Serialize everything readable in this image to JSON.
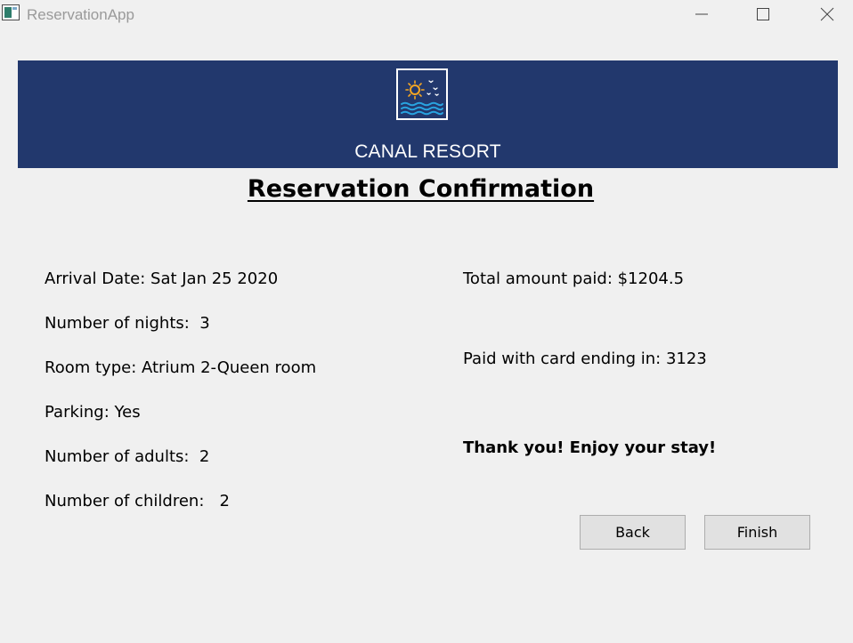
{
  "window": {
    "title": "ReservationApp"
  },
  "banner": {
    "resort_name": "CANAL RESORT",
    "colors": {
      "background": "#22386d",
      "sun": "#f5a623",
      "waves": "#29a3e0",
      "birds": "#ffffff"
    }
  },
  "page": {
    "title": "Reservation Confirmation"
  },
  "details": {
    "arrival": "Arrival Date: Sat Jan 25 2020",
    "nights": "Number of nights:  3",
    "room_type": "Room type: Atrium 2-Queen room",
    "parking": "Parking: Yes",
    "adults": "Number of adults:  2",
    "children": "Number of children:   2"
  },
  "payment": {
    "total": "Total amount paid: $1204.5",
    "card": "Paid with card ending in: 3123",
    "thanks": "Thank you! Enjoy your stay!"
  },
  "buttons": {
    "back": "Back",
    "finish": "Finish"
  },
  "icons": {
    "app": "app-window-icon",
    "minimize": "minimize-icon",
    "maximize": "maximize-icon",
    "close": "close-icon",
    "logo": "sun-waves-logo-icon"
  }
}
